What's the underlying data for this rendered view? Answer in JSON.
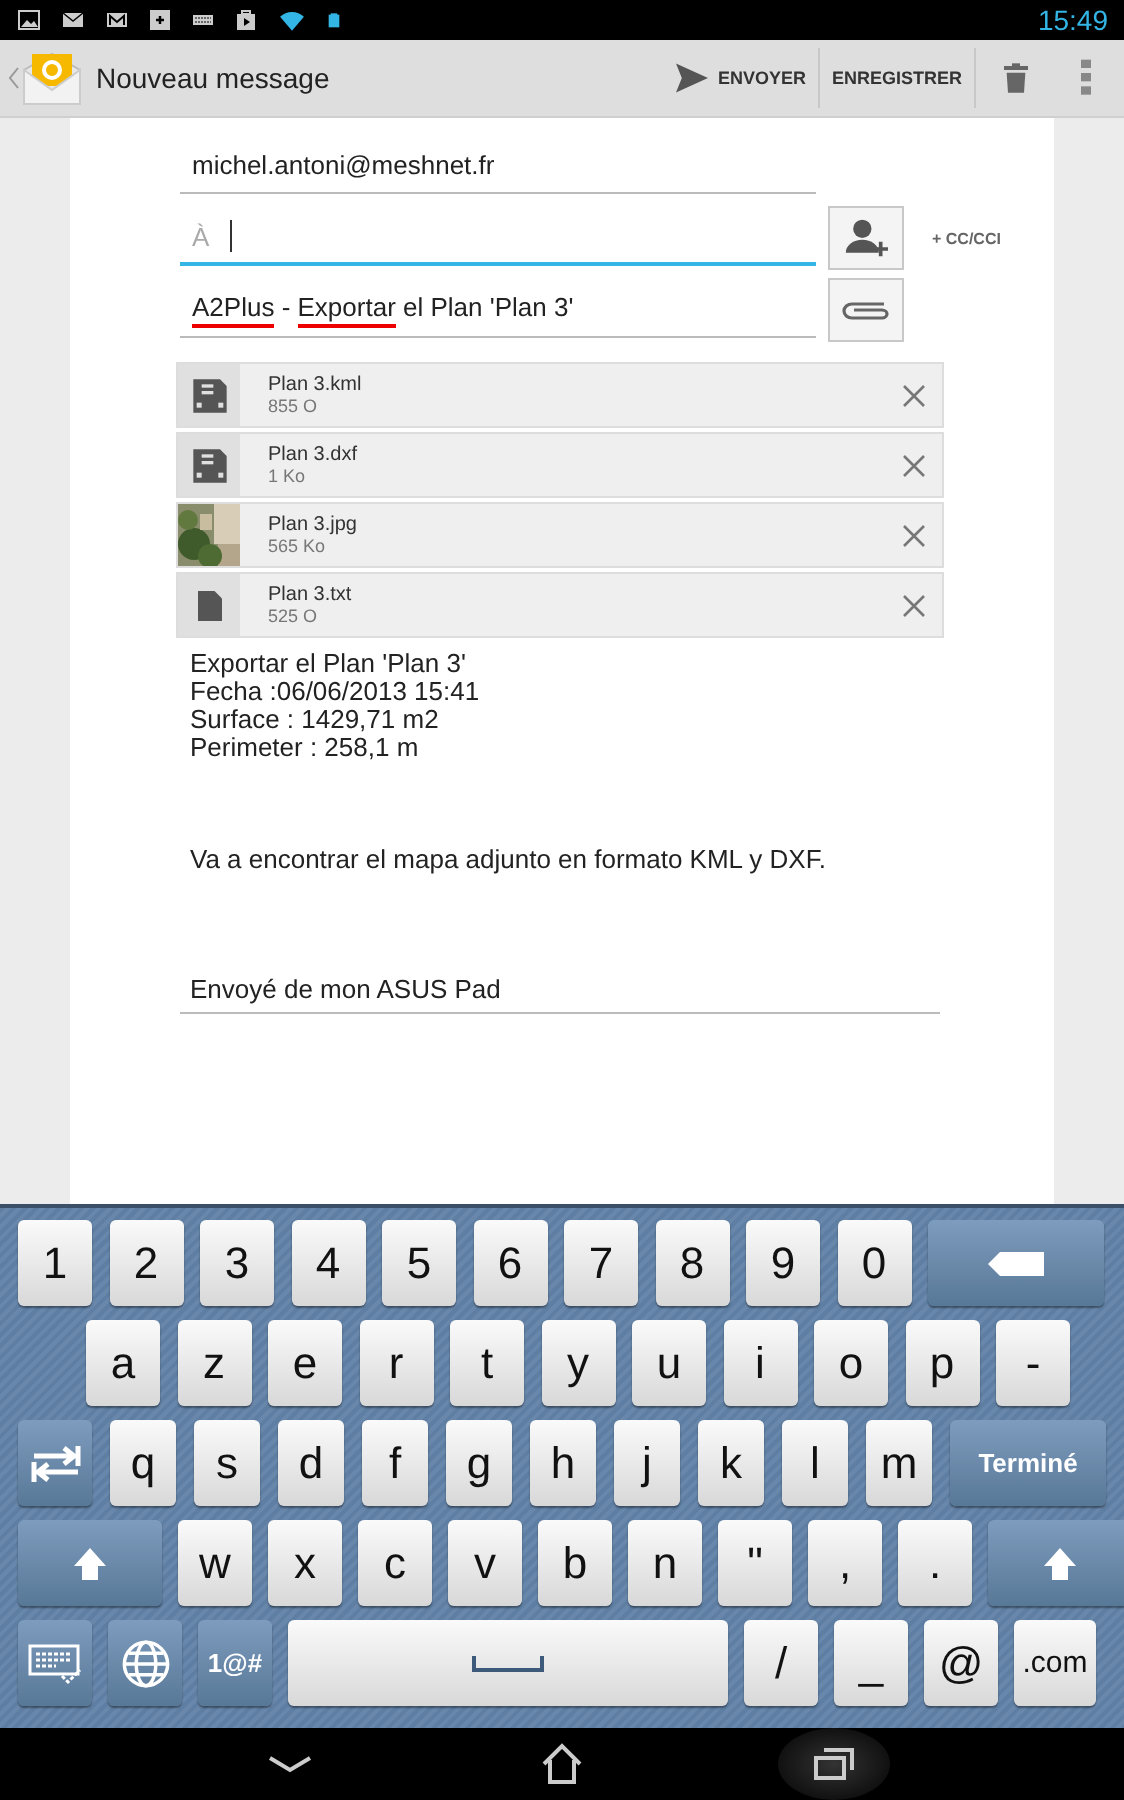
{
  "status_bar": {
    "time": "15:49"
  },
  "action_bar": {
    "title": "Nouveau message",
    "actions": [
      {
        "kind": "send",
        "label": "ENVOYER"
      },
      {
        "kind": "text",
        "label": "ENREGISTRER"
      },
      {
        "kind": "delete"
      },
      {
        "kind": "overflow"
      }
    ]
  },
  "from": {
    "value": "michel.antoni@meshnet.fr"
  },
  "to": {
    "placeholder": "À",
    "focused": true,
    "cc_label": "+ CC/CCI"
  },
  "subject": {
    "segments": [
      {
        "text": "A2Plus",
        "misspelled": true
      },
      {
        "text": " - ",
        "misspelled": false
      },
      {
        "text": "Exportar",
        "misspelled": true
      },
      {
        "text": " el Plan 'Plan 3'",
        "misspelled": false
      }
    ]
  },
  "attachments": [
    {
      "kind": "file",
      "name": "Plan 3.kml",
      "size": "855 O"
    },
    {
      "kind": "file",
      "name": "Plan 3.dxf",
      "size": "1 Ko"
    },
    {
      "kind": "picture",
      "name": "Plan 3.jpg",
      "size": "565 Ko"
    },
    {
      "kind": "document",
      "name": "Plan 3.txt",
      "size": "525 O"
    }
  ],
  "body": {
    "paragraphs": [
      {
        "lines": [
          "Exportar el Plan 'Plan 3'",
          "Fecha :06/06/2013 15:41",
          "Surface : 1429,71 m2",
          "Perimeter : 258,1 m"
        ]
      },
      {
        "lines": [
          "Va a encontrar el mapa adjunto en formato KML y DXF."
        ]
      }
    ]
  },
  "signature": "Envoyé de mon ASUS Pad",
  "keyboard": {
    "rows": [
      {
        "keys": [
          {
            "kind": "char",
            "label": "1"
          },
          {
            "kind": "char",
            "label": "2"
          },
          {
            "kind": "char",
            "label": "3"
          },
          {
            "kind": "char",
            "label": "4"
          },
          {
            "kind": "char",
            "label": "5"
          },
          {
            "kind": "char",
            "label": "6"
          },
          {
            "kind": "char",
            "label": "7"
          },
          {
            "kind": "char",
            "label": "8"
          },
          {
            "kind": "char",
            "label": "9"
          },
          {
            "kind": "char",
            "label": "0"
          },
          {
            "kind": "backspace"
          }
        ]
      },
      {
        "keys": [
          {
            "kind": "char",
            "label": "a"
          },
          {
            "kind": "char",
            "label": "z"
          },
          {
            "kind": "char",
            "label": "e"
          },
          {
            "kind": "char",
            "label": "r"
          },
          {
            "kind": "char",
            "label": "t"
          },
          {
            "kind": "char",
            "label": "y"
          },
          {
            "kind": "char",
            "label": "u"
          },
          {
            "kind": "char",
            "label": "i"
          },
          {
            "kind": "char",
            "label": "o"
          },
          {
            "kind": "char",
            "label": "p"
          },
          {
            "kind": "char",
            "label": "-"
          }
        ]
      },
      {
        "keys": [
          {
            "kind": "tab"
          },
          {
            "kind": "char",
            "label": "q"
          },
          {
            "kind": "char",
            "label": "s"
          },
          {
            "kind": "char",
            "label": "d"
          },
          {
            "kind": "char",
            "label": "f"
          },
          {
            "kind": "char",
            "label": "g"
          },
          {
            "kind": "char",
            "label": "h"
          },
          {
            "kind": "char",
            "label": "j"
          },
          {
            "kind": "char",
            "label": "k"
          },
          {
            "kind": "char",
            "label": "l"
          },
          {
            "kind": "char",
            "label": "m"
          },
          {
            "kind": "done",
            "label": "Terminé"
          }
        ]
      },
      {
        "keys": [
          {
            "kind": "shift"
          },
          {
            "kind": "char",
            "label": "w"
          },
          {
            "kind": "char",
            "label": "x"
          },
          {
            "kind": "char",
            "label": "c"
          },
          {
            "kind": "char",
            "label": "v"
          },
          {
            "kind": "char",
            "label": "b"
          },
          {
            "kind": "char",
            "label": "n"
          },
          {
            "kind": "char",
            "label": "\""
          },
          {
            "kind": "char",
            "label": ","
          },
          {
            "kind": "char",
            "label": "."
          },
          {
            "kind": "shift"
          }
        ]
      },
      {
        "keys": [
          {
            "kind": "keyboard"
          },
          {
            "kind": "globe"
          },
          {
            "kind": "symbols",
            "label": "1@#"
          },
          {
            "kind": "space"
          },
          {
            "kind": "char",
            "label": "/"
          },
          {
            "kind": "char",
            "label": "_"
          },
          {
            "kind": "char",
            "label": "@"
          },
          {
            "kind": "char",
            "label": ".com"
          }
        ]
      }
    ]
  },
  "nav_bar": {
    "buttons": [
      {
        "kind": "back",
        "selected": false
      },
      {
        "kind": "home",
        "selected": false
      },
      {
        "kind": "recent",
        "selected": true
      }
    ]
  }
}
